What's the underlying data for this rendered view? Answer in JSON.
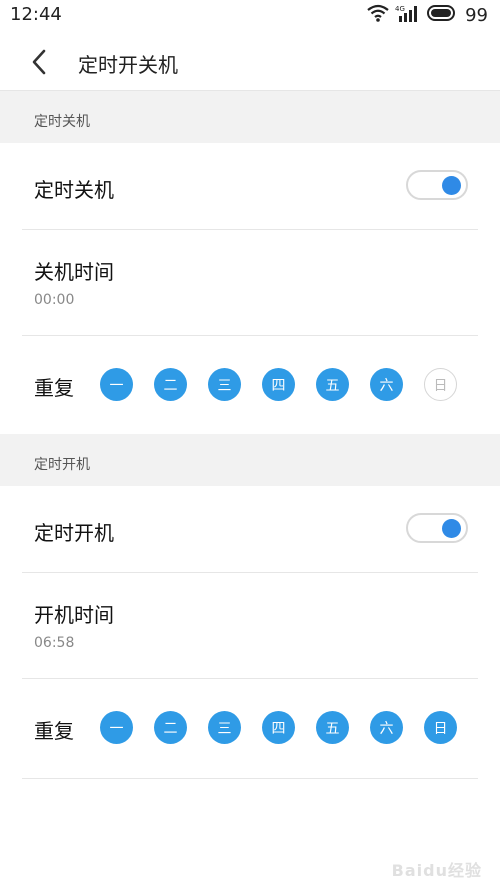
{
  "status_bar": {
    "time": "12:44",
    "battery": "99",
    "network_label": "4G"
  },
  "header": {
    "title": "定时开关机"
  },
  "shutdown": {
    "section_title": "定时关机",
    "toggle_label": "定时关机",
    "toggle_on": true,
    "time_label": "关机时间",
    "time_value": "00:00",
    "repeat_label": "重复",
    "days": [
      {
        "label": "一",
        "on": true
      },
      {
        "label": "二",
        "on": true
      },
      {
        "label": "三",
        "on": true
      },
      {
        "label": "四",
        "on": true
      },
      {
        "label": "五",
        "on": true
      },
      {
        "label": "六",
        "on": true
      },
      {
        "label": "日",
        "on": false
      }
    ]
  },
  "poweron": {
    "section_title": "定时开机",
    "toggle_label": "定时开机",
    "toggle_on": true,
    "time_label": "开机时间",
    "time_value": "06:58",
    "repeat_label": "重复",
    "days": [
      {
        "label": "一",
        "on": true
      },
      {
        "label": "二",
        "on": true
      },
      {
        "label": "三",
        "on": true
      },
      {
        "label": "四",
        "on": true
      },
      {
        "label": "五",
        "on": true
      },
      {
        "label": "六",
        "on": true
      },
      {
        "label": "日",
        "on": true
      }
    ]
  },
  "watermark": "Baidu经验",
  "colors": {
    "accent": "#2f8ae6",
    "day_on": "#2f9be6",
    "section_bg": "#f2f2f2"
  }
}
